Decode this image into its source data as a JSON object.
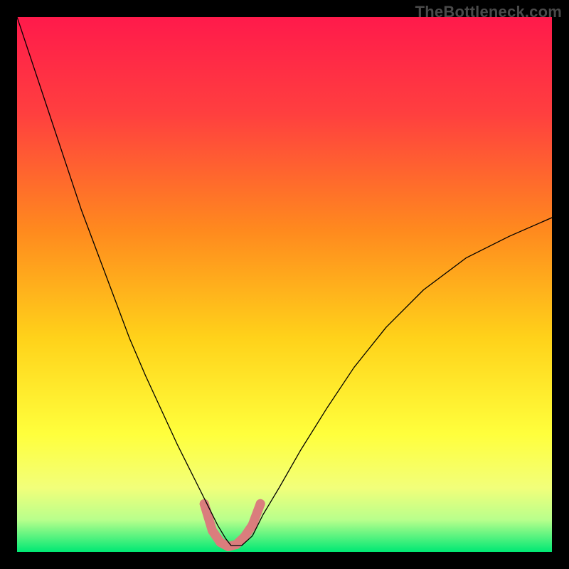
{
  "watermark": "TheBottleneck.com",
  "chart_data": {
    "type": "line",
    "title": "",
    "xlabel": "",
    "ylabel": "",
    "xlim": [
      0,
      100
    ],
    "ylim": [
      0,
      100
    ],
    "background_gradient": {
      "stops": [
        {
          "offset": 0.0,
          "color": "#ff1a4b"
        },
        {
          "offset": 0.18,
          "color": "#ff3f3f"
        },
        {
          "offset": 0.4,
          "color": "#ff8a1e"
        },
        {
          "offset": 0.6,
          "color": "#ffd21a"
        },
        {
          "offset": 0.78,
          "color": "#ffff3c"
        },
        {
          "offset": 0.88,
          "color": "#f2ff7a"
        },
        {
          "offset": 0.94,
          "color": "#b8ff8c"
        },
        {
          "offset": 1.0,
          "color": "#00e874"
        }
      ]
    },
    "series": [
      {
        "name": "bottleneck-curve",
        "color": "#000000",
        "stroke_width": 1.3,
        "x": [
          0.0,
          3.0,
          6.0,
          9.0,
          12.0,
          15.0,
          18.0,
          21.0,
          24.0,
          27.0,
          30.0,
          32.0,
          34.0,
          36.0,
          37.5,
          39.0,
          40.0,
          42.0,
          44.0,
          46.0,
          49.0,
          53.0,
          58.0,
          63.0,
          69.0,
          76.0,
          84.0,
          92.0,
          100.0
        ],
        "y": [
          100.0,
          91.0,
          82.0,
          73.0,
          64.0,
          56.0,
          48.0,
          40.0,
          33.0,
          26.5,
          20.0,
          16.0,
          12.0,
          8.0,
          5.0,
          2.5,
          1.2,
          1.2,
          3.0,
          7.0,
          12.0,
          19.0,
          27.0,
          34.5,
          42.0,
          49.0,
          55.0,
          59.0,
          62.5
        ]
      }
    ],
    "highlight": {
      "name": "optimum-highlight",
      "color": "#da7d7d",
      "dot_radius": 6.5,
      "stroke_width": 13,
      "points_x": [
        35.0,
        36.5,
        38.0,
        39.5,
        41.0,
        42.5,
        44.0,
        45.5
      ],
      "points_y": [
        9.0,
        4.0,
        1.8,
        1.0,
        1.4,
        2.8,
        5.0,
        9.0
      ]
    }
  }
}
